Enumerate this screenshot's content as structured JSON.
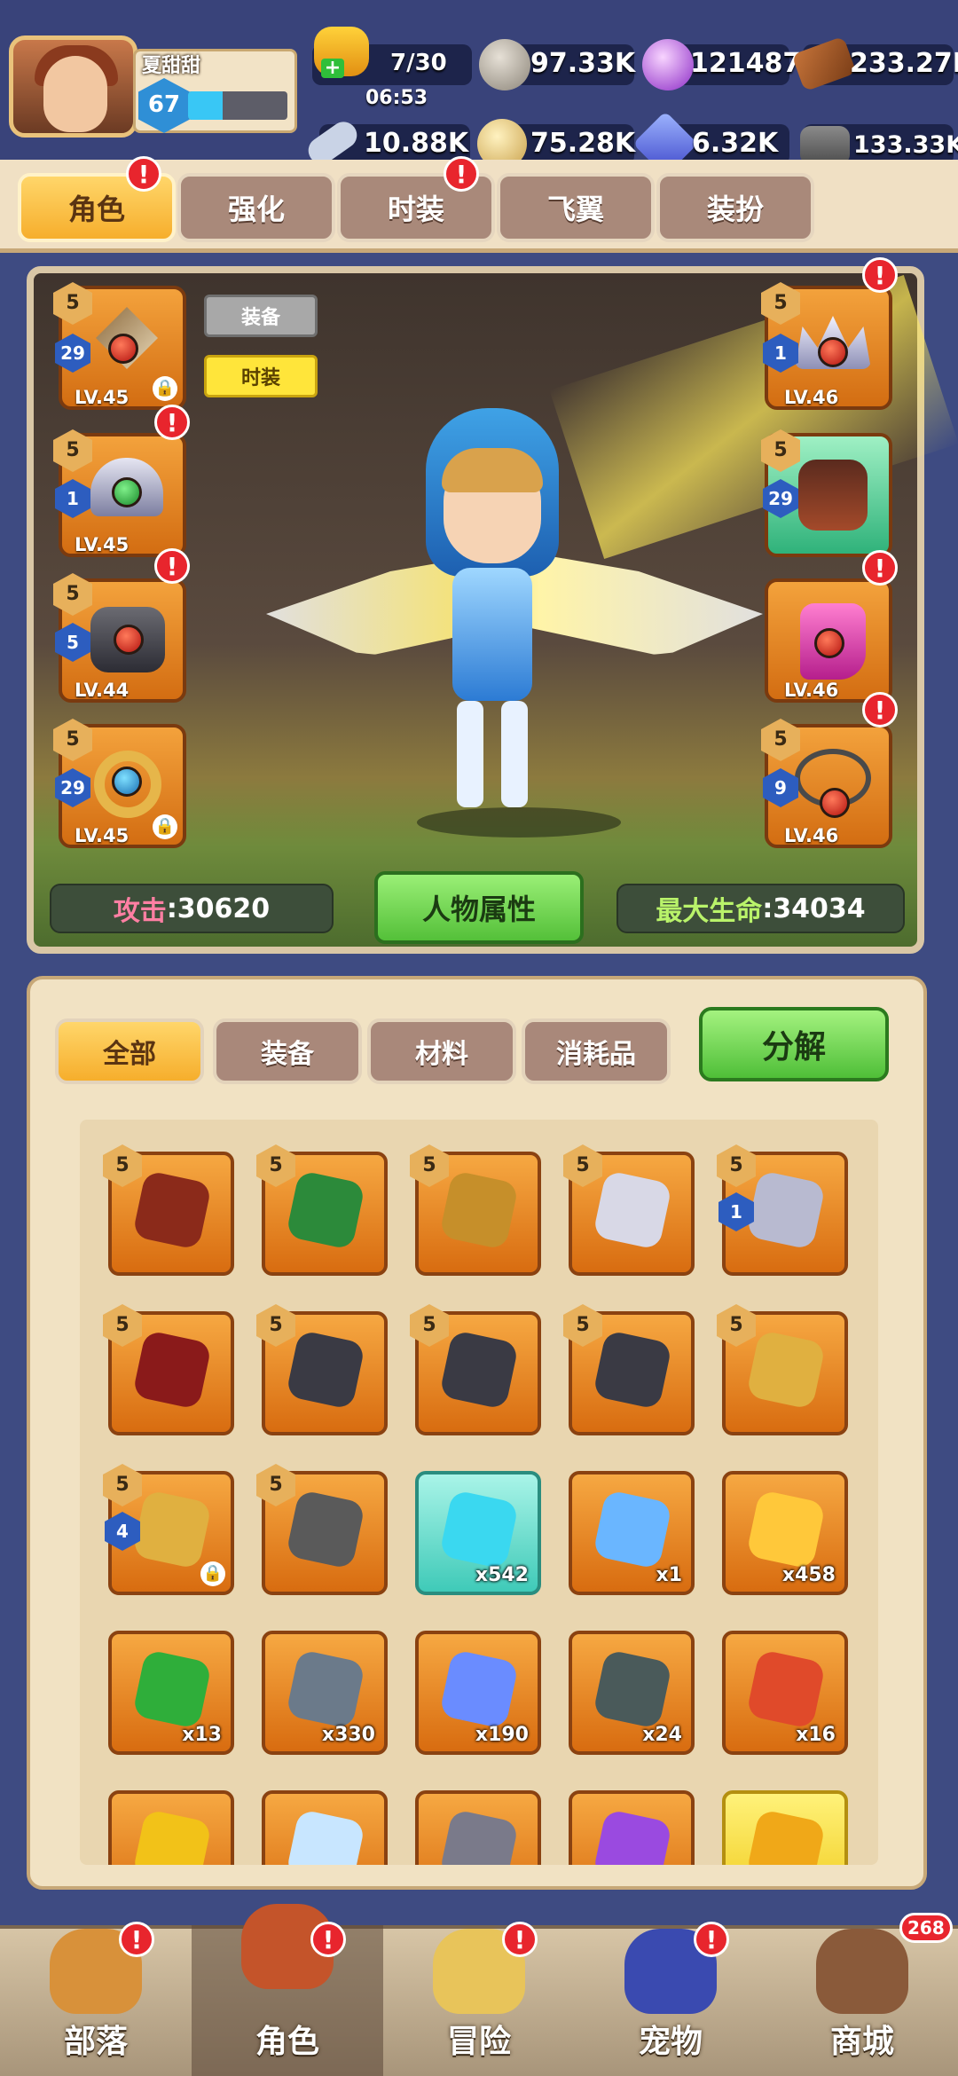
{
  "player": {
    "name": "夏甜甜",
    "level": "67",
    "xp_fraction": 0.35
  },
  "stamina": {
    "value": "7/30",
    "timer": "06:53"
  },
  "resources": [
    {
      "icon": "stone-coin-icon",
      "value": "97.33K"
    },
    {
      "icon": "purple-gem-icon",
      "value": "121487"
    },
    {
      "icon": "wood-logs-icon",
      "value": "233.27K"
    },
    {
      "icon": "bone-icon",
      "value": "10.88K"
    },
    {
      "icon": "gold-ore-icon",
      "value": "75.28K"
    },
    {
      "icon": "blue-crystal-icon",
      "value": "6.32K"
    },
    {
      "icon": "iron-ore-icon",
      "value": "133.33K"
    }
  ],
  "top_tabs": [
    {
      "label": "角色",
      "active": true,
      "badge": true
    },
    {
      "label": "强化",
      "active": false,
      "badge": false
    },
    {
      "label": "时装",
      "active": false,
      "badge": true
    },
    {
      "label": "飞翼",
      "active": false,
      "badge": false
    },
    {
      "label": "装扮",
      "active": false,
      "badge": false
    }
  ],
  "view_toggle": {
    "equip": "装备",
    "fashion": "时装"
  },
  "left_slots": [
    {
      "star": "5",
      "enhance": "29",
      "level": "LV.45",
      "locked": true,
      "badge": false,
      "icon": "bow-icon"
    },
    {
      "star": "5",
      "enhance": "1",
      "level": "LV.45",
      "locked": false,
      "badge": true,
      "icon": "helmet-icon"
    },
    {
      "star": "5",
      "enhance": "5",
      "level": "LV.44",
      "locked": false,
      "badge": true,
      "icon": "armor-icon"
    },
    {
      "star": "5",
      "enhance": "29",
      "level": "LV.45",
      "locked": true,
      "badge": false,
      "icon": "ring-icon"
    }
  ],
  "right_slots": [
    {
      "star": "5",
      "enhance": "1",
      "level": "LV.46",
      "badge": true,
      "icon": "crown-icon"
    },
    {
      "star": "5",
      "enhance": "29",
      "level": "",
      "badge": false,
      "icon": "gloves-icon"
    },
    {
      "star": "",
      "enhance": "",
      "level": "LV.46",
      "badge": true,
      "icon": "boots-icon"
    },
    {
      "star": "5",
      "enhance": "9",
      "level": "LV.46",
      "badge": true,
      "icon": "necklace-icon"
    }
  ],
  "stats": {
    "attack_label": "攻击",
    "attack_value": ":30620",
    "attr_button": "人物属性",
    "hp_label": "最大生命",
    "hp_value": ":34034"
  },
  "inventory_tabs": [
    {
      "label": "全部",
      "active": true
    },
    {
      "label": "装备",
      "active": false
    },
    {
      "label": "材料",
      "active": false
    },
    {
      "label": "消耗品",
      "active": false
    }
  ],
  "decompose_label": "分解",
  "inventory": [
    {
      "icon": "bow-icon",
      "star": "5",
      "enhance": "",
      "qty": "",
      "locked": false,
      "style": "orange"
    },
    {
      "icon": "crossbow-icon",
      "star": "5",
      "enhance": "",
      "qty": "",
      "locked": false,
      "style": "orange"
    },
    {
      "icon": "staff-icon",
      "star": "5",
      "enhance": "",
      "qty": "",
      "locked": false,
      "style": "orange"
    },
    {
      "icon": "crown-icon",
      "star": "5",
      "enhance": "",
      "qty": "",
      "locked": false,
      "style": "orange"
    },
    {
      "icon": "helmet-icon",
      "star": "5",
      "enhance": "1",
      "qty": "",
      "locked": false,
      "style": "orange"
    },
    {
      "icon": "gauntlet-icon",
      "star": "5",
      "enhance": "",
      "qty": "",
      "locked": false,
      "style": "orange"
    },
    {
      "icon": "armor-icon",
      "star": "5",
      "enhance": "",
      "qty": "",
      "locked": false,
      "style": "orange"
    },
    {
      "icon": "armor-icon",
      "star": "5",
      "enhance": "",
      "qty": "",
      "locked": false,
      "style": "orange"
    },
    {
      "icon": "armor-icon",
      "star": "5",
      "enhance": "",
      "qty": "",
      "locked": false,
      "style": "orange"
    },
    {
      "icon": "ring-icon",
      "star": "5",
      "enhance": "",
      "qty": "",
      "locked": false,
      "style": "orange"
    },
    {
      "icon": "ring-icon",
      "star": "5",
      "enhance": "4",
      "qty": "",
      "locked": true,
      "style": "orange"
    },
    {
      "icon": "necklace-icon",
      "star": "5",
      "enhance": "",
      "qty": "",
      "locked": false,
      "style": "orange"
    },
    {
      "icon": "crystal-icon",
      "star": "",
      "enhance": "",
      "qty": "x542",
      "locked": false,
      "style": "teal"
    },
    {
      "icon": "key-icon",
      "star": "",
      "enhance": "",
      "qty": "x1",
      "locked": false,
      "style": "orange"
    },
    {
      "icon": "potion-jar-icon",
      "star": "",
      "enhance": "",
      "qty": "x458",
      "locked": false,
      "style": "orange"
    },
    {
      "icon": "green-potion-icon",
      "star": "",
      "enhance": "",
      "qty": "x13",
      "locked": false,
      "style": "orange"
    },
    {
      "icon": "hammer-icon",
      "star": "",
      "enhance": "",
      "qty": "x330",
      "locked": false,
      "style": "orange"
    },
    {
      "icon": "blue-gem-icon",
      "star": "",
      "enhance": "",
      "qty": "x190",
      "locked": false,
      "style": "orange"
    },
    {
      "icon": "rune-stone-icon",
      "star": "",
      "enhance": "",
      "qty": "x24",
      "locked": false,
      "style": "orange"
    },
    {
      "icon": "red-crystal-icon",
      "star": "",
      "enhance": "",
      "qty": "x16",
      "locked": false,
      "style": "orange"
    },
    {
      "icon": "gold-emblem-icon",
      "star": "",
      "enhance": "",
      "qty": "",
      "locked": false,
      "style": "orange"
    },
    {
      "icon": "diamond-icon",
      "star": "",
      "enhance": "",
      "qty": "",
      "locked": false,
      "style": "orange"
    },
    {
      "icon": "anvil-icon",
      "star": "",
      "enhance": "",
      "qty": "",
      "locked": false,
      "style": "orange"
    },
    {
      "icon": "purple-shard-icon",
      "star": "",
      "enhance": "",
      "qty": "",
      "locked": false,
      "style": "orange"
    },
    {
      "icon": "gold-shard-icon",
      "star": "",
      "enhance": "",
      "qty": "",
      "locked": false,
      "style": "gold"
    }
  ],
  "nav": [
    {
      "label": "部落",
      "icon": "tribe-icon",
      "active": false,
      "badge": "!"
    },
    {
      "label": "角色",
      "icon": "character-icon",
      "active": true,
      "badge": "!"
    },
    {
      "label": "冒险",
      "icon": "map-icon",
      "active": false,
      "badge": "!"
    },
    {
      "label": "宠物",
      "icon": "pet-icon",
      "active": false,
      "badge": "!"
    },
    {
      "label": "商城",
      "icon": "shop-icon",
      "active": false,
      "badge": "268"
    }
  ],
  "colors": {
    "accent_green": "#54c039",
    "tab_active": "#f6ae2c",
    "badge_red": "#e8252d"
  }
}
